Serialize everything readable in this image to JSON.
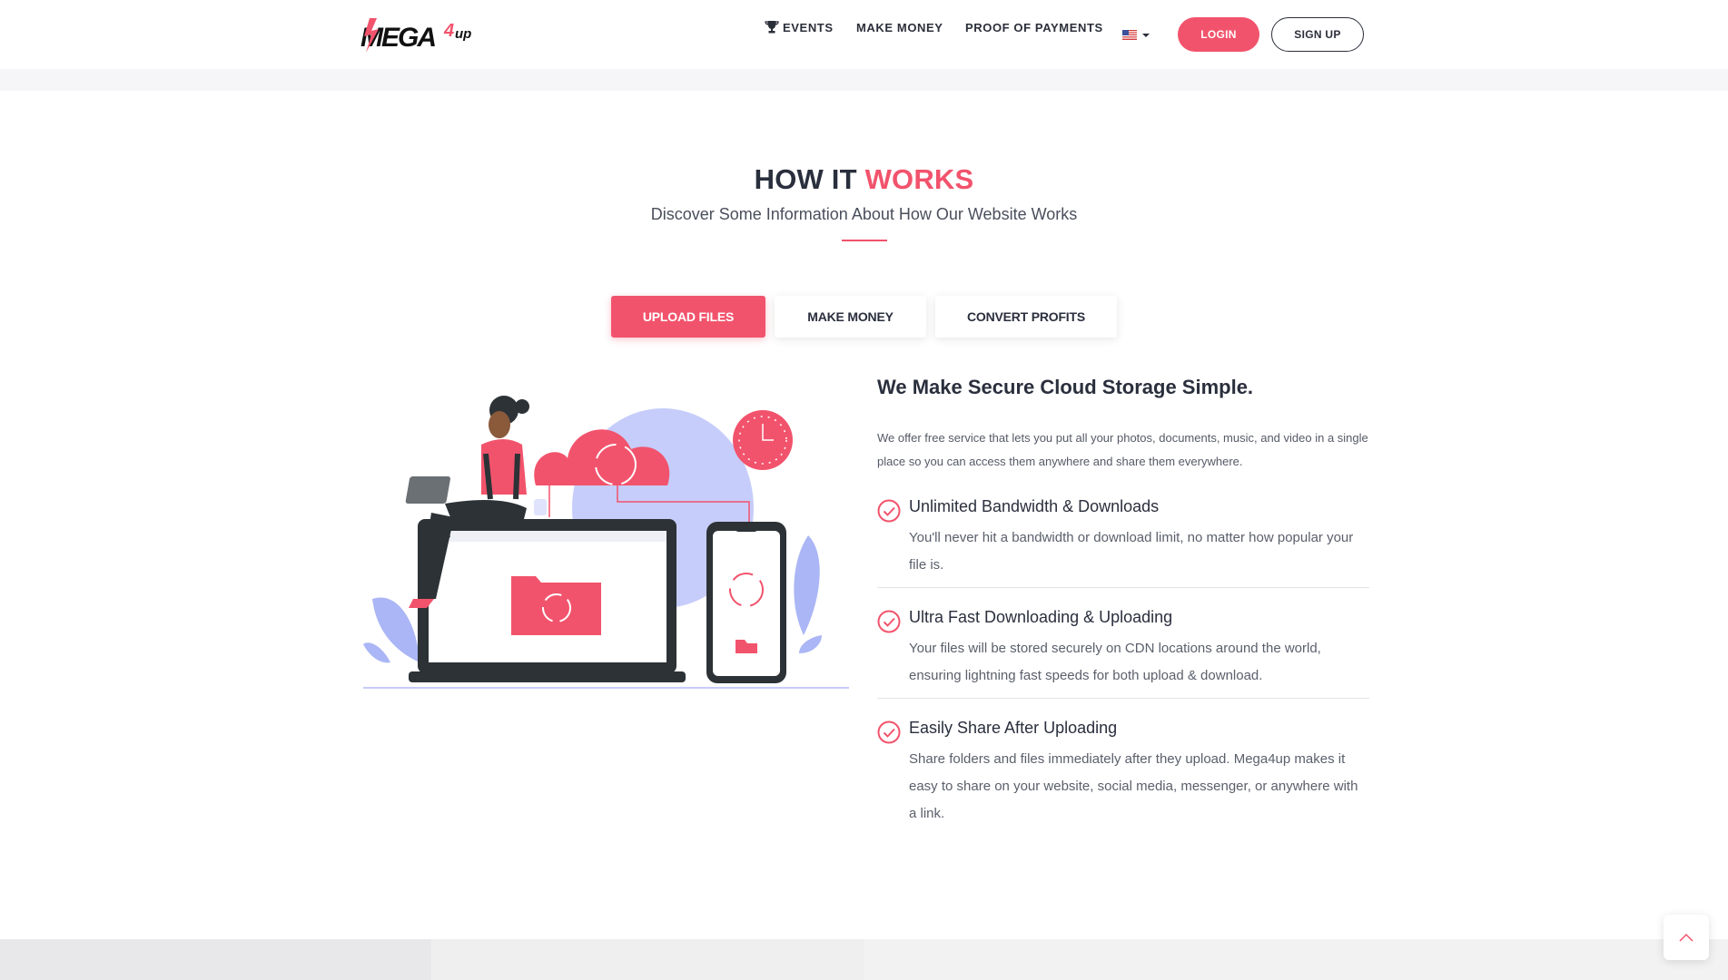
{
  "brand": {
    "logo_text": "MEGA4up",
    "accent": "#f2536c",
    "dark": "#2a2f3d"
  },
  "nav": {
    "events": "EVENTS",
    "make_money": "MAKE MONEY",
    "proof_of_payments": "PROOF OF PAYMENTS",
    "language_icon": "us-flag-icon",
    "login": "LOGIN",
    "signup": "SIGN UP"
  },
  "how_it_works": {
    "title_part1": "HOW IT",
    "title_part2": "WORKS",
    "subtitle": "Discover Some Information About How Our Website Works"
  },
  "tabs": [
    {
      "label": "UPLOAD FILES",
      "active": true
    },
    {
      "label": "MAKE MONEY",
      "active": false
    },
    {
      "label": "CONVERT PROFITS",
      "active": false
    }
  ],
  "content": {
    "title": "We Make Secure Cloud Storage Simple.",
    "description": "We offer free service that lets you put all your photos, documents, music, and video in a single place so you can access them anywhere and share them everywhere.",
    "features": [
      {
        "title": "Unlimited Bandwidth & Downloads",
        "text": "You'll never hit a bandwidth or download limit, no matter how popular your file is."
      },
      {
        "title": "Ultra Fast Downloading & Uploading",
        "text": "Your files will be stored securely on CDN locations around the world, ensuring lightning fast speeds for both upload & download."
      },
      {
        "title": "Easily Share After Uploading",
        "text": "Share folders and files immediately after they upload. Mega4up makes it easy to share on your website, social media, messenger, or anywhere with a link."
      }
    ]
  }
}
